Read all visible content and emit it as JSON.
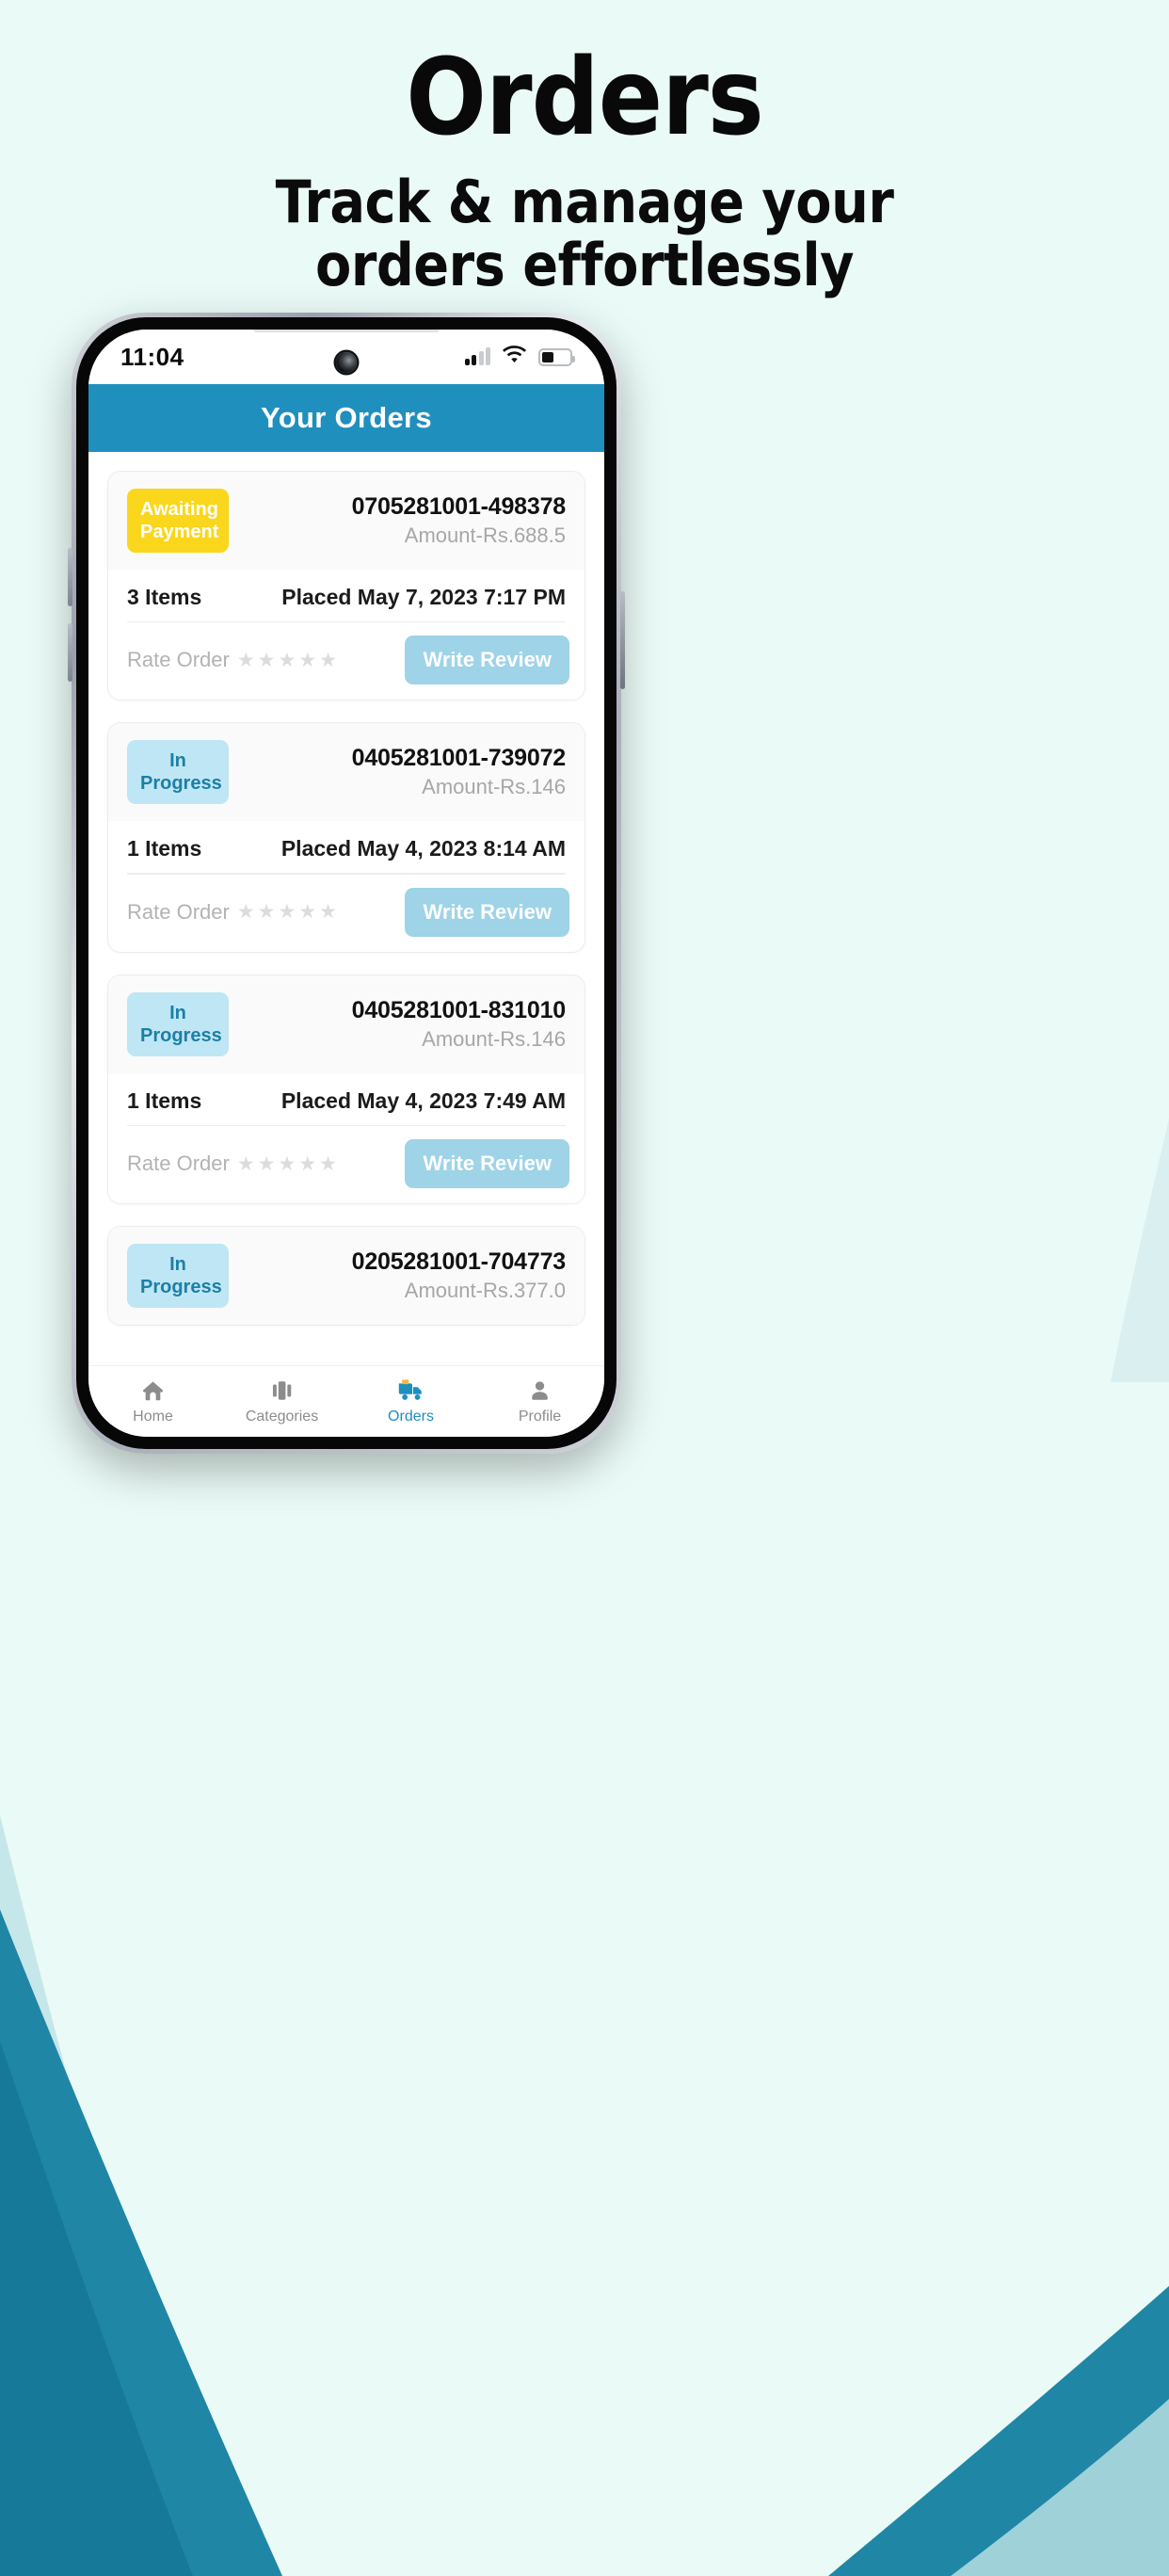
{
  "promo": {
    "title": "Orders",
    "subtitle_line1": "Track & manage your",
    "subtitle_line2": "orders effortlessly",
    "bg_color": "#eafaf6",
    "accent_color": "#1f8fbe"
  },
  "status_bar": {
    "time": "11:04",
    "signal_icon": "signal-bars-icon",
    "signal_bars_filled": 2,
    "signal_bars_total": 4,
    "wifi_icon": "wifi-icon",
    "battery_icon": "battery-icon",
    "battery_percent": 43,
    "camera_icon": "front-camera-icon"
  },
  "app_header": {
    "title": "Your Orders",
    "background": "#1f8fbe"
  },
  "orders": [
    {
      "status": "Awaiting\nPayment",
      "status_line1": "Awaiting",
      "status_line2": "Payment",
      "status_type": "awaiting",
      "order_no": "0705281001-498378",
      "amount": "Amount-Rs.688.5",
      "items": "3 Items",
      "placed": "Placed May 7, 2023 7:17 PM",
      "rate_label": "Rate Order",
      "rating": 0,
      "review_button": "Write Review"
    },
    {
      "status_line1": "In Progress",
      "status_line2": "",
      "status_type": "inprogress",
      "order_no": "0405281001-739072",
      "amount": "Amount-Rs.146",
      "items": "1 Items",
      "placed": "Placed May 4, 2023 8:14 AM",
      "rate_label": "Rate Order",
      "rating": 0,
      "review_button": "Write Review"
    },
    {
      "status_line1": "In Progress",
      "status_line2": "",
      "status_type": "inprogress",
      "order_no": "0405281001-831010",
      "amount": "Amount-Rs.146",
      "items": "1 Items",
      "placed": "Placed May 4, 2023 7:49 AM",
      "rate_label": "Rate Order",
      "rating": 0,
      "review_button": "Write Review"
    },
    {
      "status_line1": "In Progress",
      "status_line2": "",
      "status_type": "inprogress",
      "order_no": "0205281001-704773",
      "amount": "Amount-Rs.377.0",
      "items": "",
      "placed": "",
      "rate_label": "",
      "rating": 0,
      "review_button": ""
    }
  ],
  "bottom_nav": {
    "items": [
      {
        "label": "Home",
        "icon": "home-icon",
        "active": false
      },
      {
        "label": "Categories",
        "icon": "categories-icon",
        "active": false
      },
      {
        "label": "Orders",
        "icon": "truck-icon",
        "active": true
      },
      {
        "label": "Profile",
        "icon": "person-icon",
        "active": false
      }
    ],
    "active_color": "#1f8fbe",
    "inactive_color": "#8c8c8c"
  },
  "star_glyph": "★"
}
